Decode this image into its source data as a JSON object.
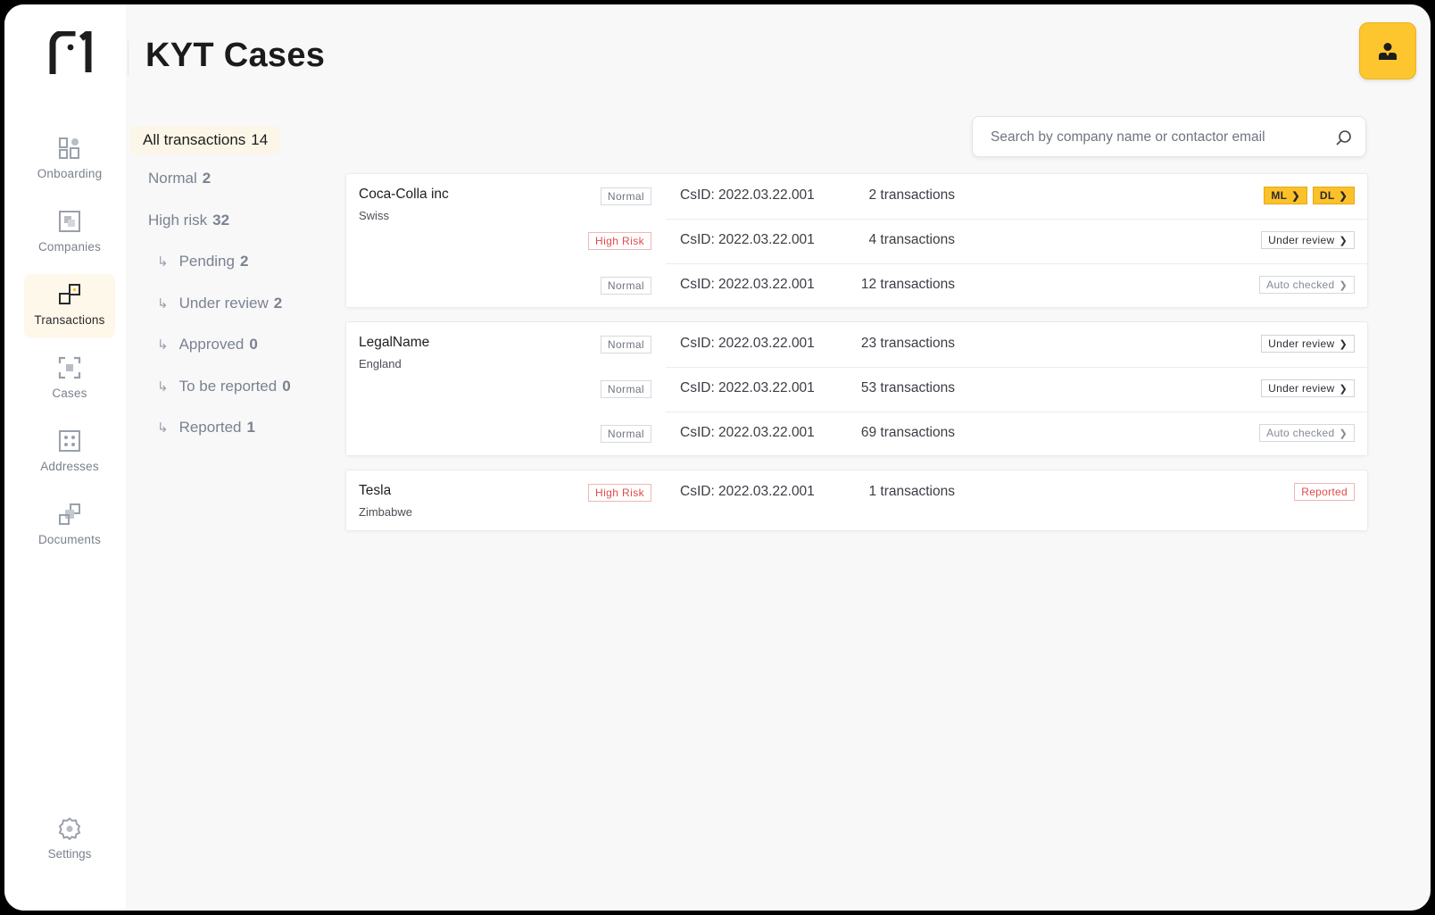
{
  "header": {
    "title": "KYT Cases"
  },
  "nav": {
    "onboarding": "Onboarding",
    "companies": "Companies",
    "transactions": "Transactions",
    "cases": "Cases",
    "addresses": "Addresses",
    "documents": "Documents",
    "settings": "Settings"
  },
  "filters": {
    "all": {
      "label": "All transactions",
      "count": "14"
    },
    "normal": {
      "label": "Normal",
      "count": "2"
    },
    "high_risk": {
      "label": "High risk",
      "count": "32"
    },
    "pending": {
      "label": "Pending",
      "count": "2"
    },
    "under_review": {
      "label": "Under review",
      "count": "2"
    },
    "approved": {
      "label": "Approved",
      "count": "0"
    },
    "to_be_reported": {
      "label": "To be reported",
      "count": "0"
    },
    "reported": {
      "label": "Reported",
      "count": "1"
    }
  },
  "search": {
    "placeholder": "Search by company name or contactor email"
  },
  "cards": [
    {
      "name": "Coca-Colla inc",
      "country": "Swiss",
      "rows": [
        {
          "risk": "Normal",
          "csid": "CsID: 2022.03.22.001",
          "tx": "2 transactions",
          "actions": [
            "ML",
            "DL"
          ]
        },
        {
          "risk": "High Risk",
          "csid": "CsID: 2022.03.22.001",
          "tx": "4 transactions",
          "actions": [
            "Under review"
          ]
        },
        {
          "risk": "Normal",
          "csid": "CsID: 2022.03.22.001",
          "tx": "12 transactions",
          "actions": [
            "Auto checked"
          ]
        }
      ]
    },
    {
      "name": "LegalName",
      "country": "England",
      "rows": [
        {
          "risk": "Normal",
          "csid": "CsID: 2022.03.22.001",
          "tx": "23 transactions",
          "actions": [
            "Under review"
          ]
        },
        {
          "risk": "Normal",
          "csid": "CsID: 2022.03.22.001",
          "tx": "53 transactions",
          "actions": [
            "Under review"
          ]
        },
        {
          "risk": "Normal",
          "csid": "CsID: 2022.03.22.001",
          "tx": "69 transactions",
          "actions": [
            "Auto checked"
          ]
        }
      ]
    },
    {
      "name": "Tesla",
      "country": "Zimbabwe",
      "rows": [
        {
          "risk": "High Risk",
          "csid": "CsID: 2022.03.22.001",
          "tx": "1 transactions",
          "actions": [
            "Reported"
          ]
        }
      ]
    }
  ],
  "colors": {
    "accent": "#fdc62f",
    "danger": "#e04a4a",
    "background": "#f8f8f9"
  }
}
